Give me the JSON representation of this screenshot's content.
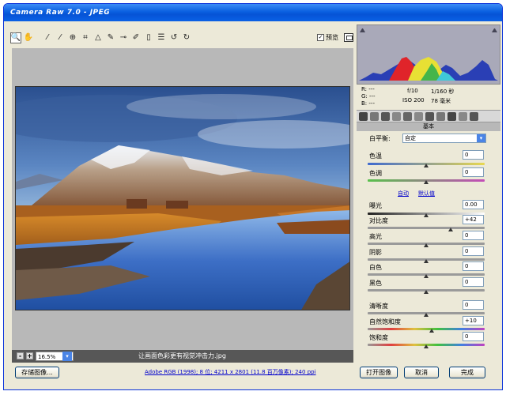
{
  "window": {
    "title": "Camera Raw 7.0 - JPEG"
  },
  "toolbar": {
    "preview_label": "预览",
    "preview_checked": true
  },
  "zoom": {
    "minus": "-",
    "plus": "+",
    "value": "16.5%",
    "dropdown": "▾"
  },
  "image": {
    "filename": "让画面色彩更有视觉冲击力.jpg"
  },
  "bottom": {
    "save_label": "存储图像...",
    "workflow": "Adobe RGB (1998); 8 位; 4211 x 2801 (11.8 百万像素); 240 ppi",
    "open_label": "打开图像",
    "cancel_label": "取消",
    "done_label": "完成"
  },
  "info": {
    "r": "R:  ---",
    "g": "G:  ---",
    "b": "B:  ---",
    "aperture": "f/10",
    "shutter": "1/160 秒",
    "iso": "ISO 200",
    "focal": "78 毫米"
  },
  "panel": {
    "title": "基本",
    "wb_label": "白平衡:",
    "wb_value": "自定",
    "temp_label": "色温",
    "temp_value": "0",
    "tint_label": "色调",
    "tint_value": "0",
    "auto_link": "自动",
    "default_link": "默认值",
    "exposure_label": "曝光",
    "exposure_value": "0.00",
    "contrast_label": "对比度",
    "contrast_value": "+42",
    "highlights_label": "高光",
    "highlights_value": "0",
    "shadows_label": "阴影",
    "shadows_value": "0",
    "whites_label": "白色",
    "whites_value": "0",
    "blacks_label": "黑色",
    "blacks_value": "0",
    "clarity_label": "清晰度",
    "clarity_value": "0",
    "vibrance_label": "自然饱和度",
    "vibrance_value": "+10",
    "saturation_label": "饱和度",
    "saturation_value": "0"
  },
  "sliders": {
    "temp": 0.5,
    "tint": 0.5,
    "exposure": 0.5,
    "contrast": 0.71,
    "highlights": 0.5,
    "shadows": 0.5,
    "whites": 0.5,
    "blacks": 0.5,
    "clarity": 0.5,
    "vibrance": 0.55,
    "saturation": 0.5
  },
  "icons": [
    "zoom-icon",
    "hand-icon",
    "white-balance-icon",
    "color-sampler-icon",
    "target-adjust-icon",
    "crop-icon",
    "straighten-icon",
    "spot-removal-icon",
    "red-eye-icon",
    "adjustment-brush-icon",
    "graduated-filter-icon",
    "preferences-icon",
    "rotate-ccw-icon",
    "rotate-cw-icon"
  ],
  "colors": {
    "titlebar": "#0a5fe0",
    "panel_bg": "#ECE9D8",
    "link": "#0000cc"
  }
}
